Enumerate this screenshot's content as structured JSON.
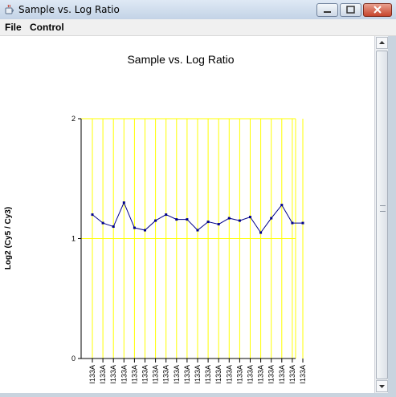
{
  "window": {
    "title": "Sample vs. Log Ratio",
    "icon": "java-cup-icon"
  },
  "menu": {
    "file": "File",
    "control": "Control"
  },
  "colors": {
    "grid": "#ffff00",
    "series": "#00008b",
    "axis": "#000000"
  },
  "chart_data": {
    "type": "line",
    "title": "Sample vs. Log Ratio",
    "xlabel": "",
    "ylabel": "Log2 (Cy5 / Cy3)",
    "ylim": [
      0,
      2
    ],
    "yticks": [
      "0",
      "1",
      "2"
    ],
    "grid": true,
    "categories": [
      "I133A",
      "I133A",
      "I133A",
      "I133A",
      "I133A",
      "I133A",
      "I133A",
      "I133A",
      "I133A",
      "I133A",
      "I133A",
      "I133A",
      "I133A",
      "I133A",
      "I133A",
      "I133A",
      "I133A",
      "I133A",
      "I133A",
      "I133A",
      "I133A"
    ],
    "series": [
      {
        "values": [
          1.2,
          1.13,
          1.1,
          1.3,
          1.09,
          1.07,
          1.15,
          1.2,
          1.16,
          1.16,
          1.07,
          1.14,
          1.12,
          1.17,
          1.15,
          1.18,
          1.05,
          1.17,
          1.28,
          1.13,
          1.13
        ]
      }
    ]
  }
}
